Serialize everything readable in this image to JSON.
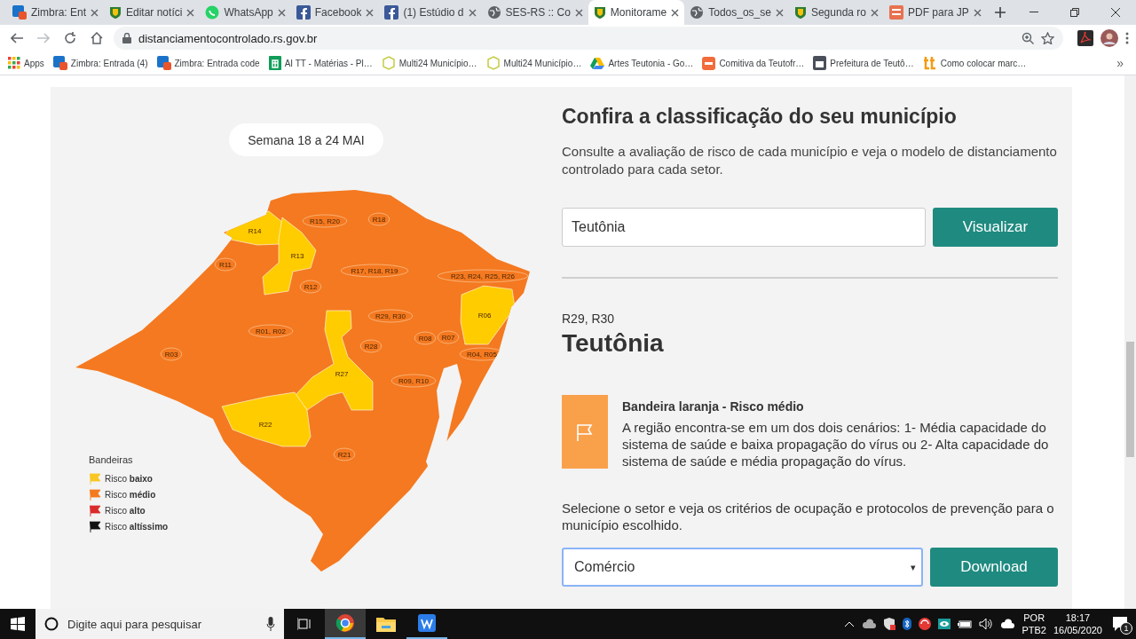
{
  "browser": {
    "tabs": [
      {
        "title": "Zimbra: Ent",
        "kind": "zimbra",
        "selected": false
      },
      {
        "title": "Editar notíci",
        "kind": "crest",
        "selected": false
      },
      {
        "title": "WhatsApp",
        "kind": "whatsapp",
        "selected": false
      },
      {
        "title": "Facebook",
        "kind": "facebook",
        "selected": false
      },
      {
        "title": "(1) Estúdio d",
        "kind": "facebook",
        "selected": false
      },
      {
        "title": "SES-RS :: Co",
        "kind": "globe",
        "selected": false
      },
      {
        "title": "Monitorame",
        "kind": "crest",
        "selected": true
      },
      {
        "title": "Todos_os_se",
        "kind": "globe",
        "selected": false
      },
      {
        "title": "Segunda ro",
        "kind": "crest",
        "selected": false
      },
      {
        "title": "PDF para JP",
        "kind": "pdf",
        "selected": false
      }
    ],
    "address": "distanciamentocontrolado.rs.gov.br",
    "bookmarks": [
      {
        "title": "Apps",
        "kind": "apps"
      },
      {
        "title": "Zimbra: Entrada (4)",
        "kind": "zimbra"
      },
      {
        "title": "Zimbra: Entrada code",
        "kind": "zimbra"
      },
      {
        "title": "AI TT - Matérias - Pl…",
        "kind": "sheet"
      },
      {
        "title": "Multi24 Município…",
        "kind": "multi"
      },
      {
        "title": "Multi24 Município…",
        "kind": "multi"
      },
      {
        "title": "Artes Teutonia - Go…",
        "kind": "drive"
      },
      {
        "title": "Comitiva da Teutofr…",
        "kind": "gzh"
      },
      {
        "title": "Prefeitura de Teutô…",
        "kind": "doc"
      },
      {
        "title": "Como colocar marc…",
        "kind": "tt"
      }
    ],
    "bookmarks_more": "»"
  },
  "map": {
    "week": "Semana 18 a 24 MAI",
    "regions": [
      {
        "label": "R14",
        "color": "#ffcc00"
      },
      {
        "label": "R15, R20",
        "color": "#f47920"
      },
      {
        "label": "R18",
        "color": "#f47920"
      },
      {
        "label": "R13",
        "color": "#ffcc00"
      },
      {
        "label": "R11",
        "color": "#f47920"
      },
      {
        "label": "R12",
        "color": "#f47920"
      },
      {
        "label": "R17, R18, R19",
        "color": "#f47920"
      },
      {
        "label": "R23, R24, R25, R26",
        "color": "#f47920"
      },
      {
        "label": "R06",
        "color": "#ffcc00"
      },
      {
        "label": "R29, R30",
        "color": "#f47920"
      },
      {
        "label": "R01, R02",
        "color": "#f47920"
      },
      {
        "label": "R08",
        "color": "#f47920"
      },
      {
        "label": "R07",
        "color": "#f47920"
      },
      {
        "label": "R28",
        "color": "#f47920"
      },
      {
        "label": "R04, R05",
        "color": "#f47920"
      },
      {
        "label": "R03",
        "color": "#f47920"
      },
      {
        "label": "R27",
        "color": "#ffcc00"
      },
      {
        "label": "R09, R10",
        "color": "#f47920"
      },
      {
        "label": "R22",
        "color": "#ffcc00"
      },
      {
        "label": "R21",
        "color": "#f47920"
      }
    ],
    "legend": {
      "title": "Bandeiras",
      "items": [
        {
          "label": "Risco **baixo**",
          "color": "#f9c623"
        },
        {
          "label": "Risco **médio**",
          "color": "#f47920"
        },
        {
          "label": "Risco **alto**",
          "color": "#d92b2b"
        },
        {
          "label": "Risco **altíssimo**",
          "color": "#111111"
        }
      ]
    }
  },
  "panel": {
    "title": "Confira a classificação do seu município",
    "description": "Consulte a avaliação de risco de cada município e veja o modelo de distanciamento controlado para cada setor.",
    "search": {
      "value": "Teutônia",
      "button": "Visualizar"
    },
    "regions": "R29, R30",
    "municipality": "Teutônia",
    "flag": {
      "color": "#f9a04a",
      "title": "Bandeira laranja - Risco médio",
      "text": "A região encontra-se em um dos dois cenários: 1- Média capacidade do sistema de saúde e baixa propagação do vírus ou 2- Alta capacidade do sistema de saúde e média propagação do vírus."
    },
    "sector_prompt": "Selecione o setor e veja os critérios de ocupação e protocolos de prevenção para o município escolhido.",
    "sector": {
      "value": "Comércio",
      "caret": "▾",
      "button": "Download"
    }
  },
  "taskbar": {
    "search_placeholder": "Digite aqui para pesquisar",
    "language": "POR",
    "layout": "PTB2",
    "time": "18:17",
    "date": "16/05/2020",
    "notifications": "1"
  }
}
